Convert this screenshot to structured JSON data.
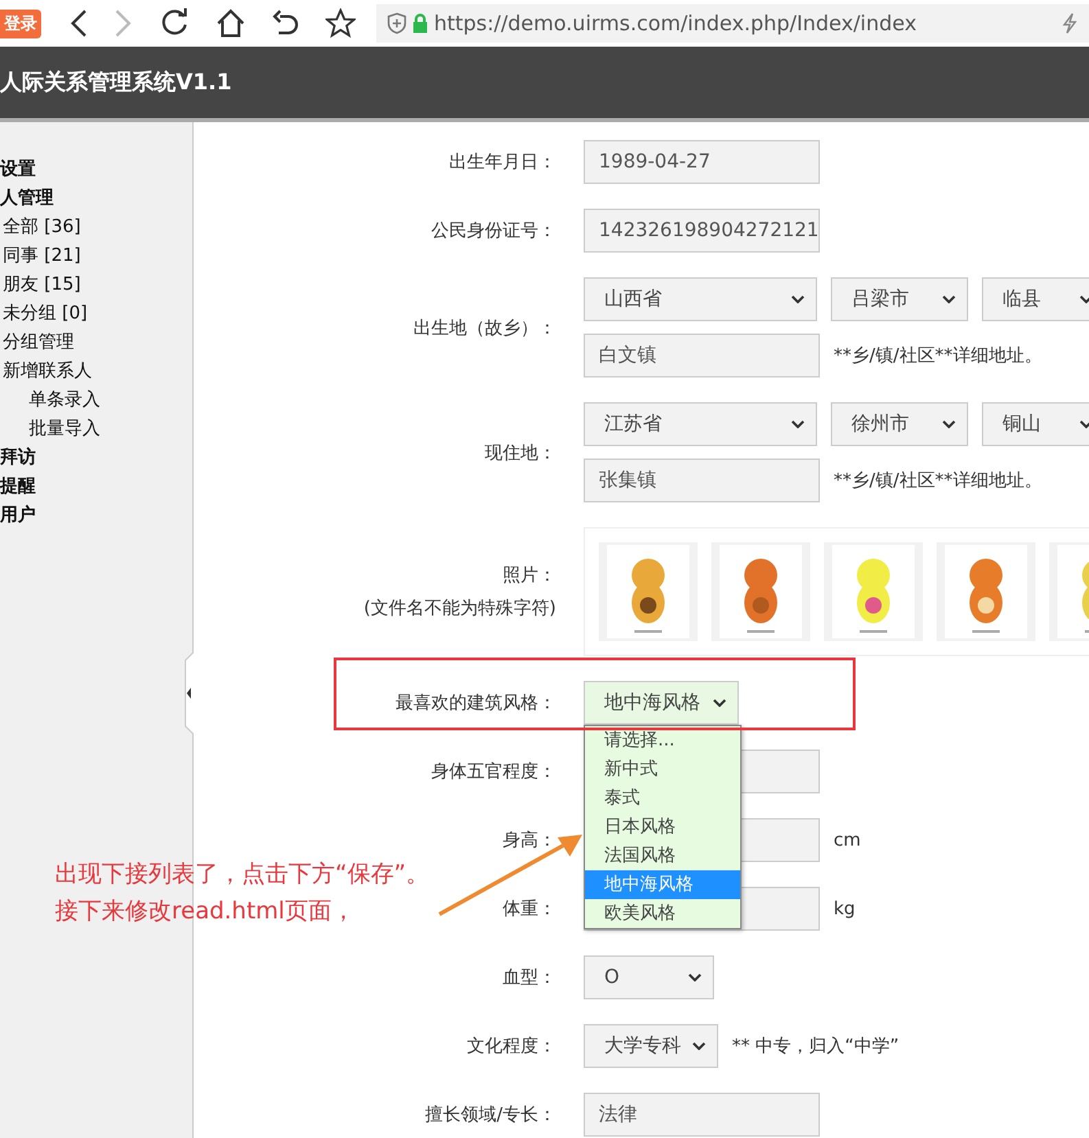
{
  "browser": {
    "login_badge": "登录",
    "forward": {
      "disabled": true
    },
    "url": "https://demo.uirms.com/index.php/Index/index"
  },
  "header": {
    "title": "人际关系管理系统V1.1"
  },
  "sidebar": {
    "items": [
      {
        "label": "设置"
      },
      {
        "label": "人管理",
        "children": [
          {
            "label": "全部 [36]"
          },
          {
            "label": "同事 [21]"
          },
          {
            "label": "朋友 [15]"
          },
          {
            "label": "未分组 [0]"
          },
          {
            "label": "分组管理"
          },
          {
            "label": "新增联系人",
            "children": [
              {
                "label": "单条录入"
              },
              {
                "label": "批量导入"
              }
            ]
          }
        ]
      },
      {
        "label": "拜访"
      },
      {
        "label": "提醒"
      },
      {
        "label": "用户"
      }
    ]
  },
  "form": {
    "rows": [
      {
        "kind": "text",
        "label": "出生年月日：",
        "value": "1989-04-27"
      },
      {
        "kind": "text",
        "label": "公民身份证号：",
        "value": "142326198904272121"
      },
      {
        "kind": "address",
        "label": "出生地（故乡）：",
        "selects": [
          "山西省",
          "吕梁市",
          "临县"
        ],
        "detail": "白文镇",
        "hint": "**乡/镇/社区**详细地址。"
      },
      {
        "kind": "address",
        "label": "现住地：",
        "selects": [
          "江苏省",
          "徐州市",
          "铜山"
        ],
        "detail": "张集镇",
        "hint": "**乡/镇/社区**详细地址。"
      },
      {
        "kind": "photos",
        "label": "照片：",
        "note": "(文件名不能为特殊字符)"
      },
      {
        "kind": "select",
        "label": "最喜欢的建筑风格：",
        "value": "地中海风格",
        "open": true,
        "highlighted": true,
        "options": [
          {
            "label": "请选择...",
            "selected": false
          },
          {
            "label": "新中式",
            "selected": false
          },
          {
            "label": "泰式",
            "selected": false
          },
          {
            "label": "日本风格",
            "selected": false
          },
          {
            "label": "法国风格",
            "selected": false
          },
          {
            "label": "地中海风格",
            "selected": true
          },
          {
            "label": "欧美风格",
            "selected": false
          }
        ]
      },
      {
        "kind": "text",
        "label": "身体五官程度："
      },
      {
        "kind": "text",
        "label": "身高：",
        "unit": "cm"
      },
      {
        "kind": "text",
        "label": "体重：",
        "unit": "kg"
      },
      {
        "kind": "select",
        "label": "血型：",
        "value": "O"
      },
      {
        "kind": "select",
        "label": "文化程度：",
        "value": "大学专科",
        "hint": "** 中专，归入“中学”"
      },
      {
        "kind": "text",
        "label": "擅长领域/专长：",
        "value": "法律"
      }
    ]
  },
  "annotation": {
    "lines": [
      "出现下接列表了，点击下方“保存”。",
      "接下来修改read.html页面，"
    ]
  }
}
